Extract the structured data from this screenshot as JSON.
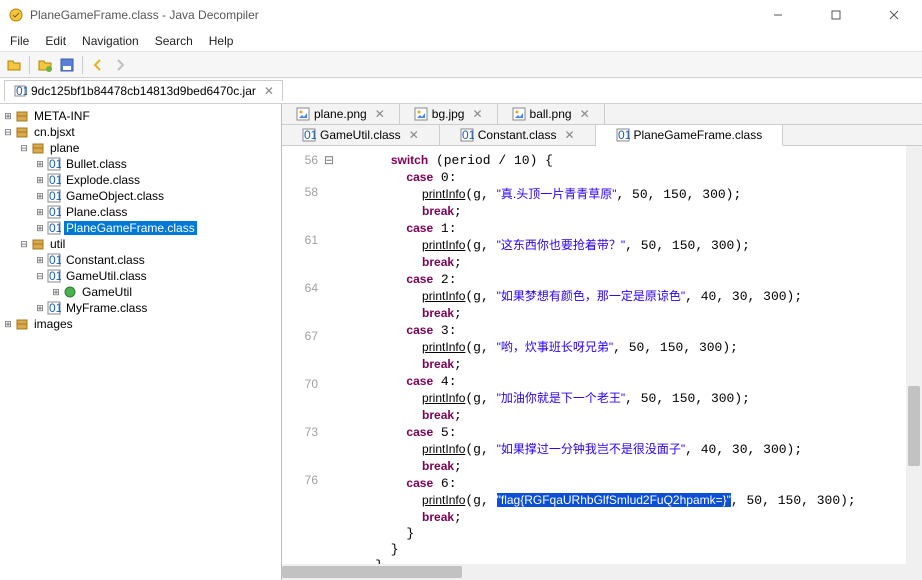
{
  "window": {
    "title": "PlaneGameFrame.class - Java Decompiler"
  },
  "menu": {
    "file": "File",
    "edit": "Edit",
    "navigation": "Navigation",
    "search": "Search",
    "help": "Help"
  },
  "filetab": {
    "label": "9dc125bf1b84478cb14813d9bed6470c.jar",
    "close": "✕"
  },
  "tree": [
    {
      "depth": 0,
      "exp": "+",
      "icon": "package",
      "label": "META-INF"
    },
    {
      "depth": 0,
      "exp": "-",
      "icon": "package",
      "label": "cn.bjsxt"
    },
    {
      "depth": 1,
      "exp": "-",
      "icon": "package",
      "label": "plane"
    },
    {
      "depth": 2,
      "exp": "+",
      "icon": "class",
      "label": "Bullet.class"
    },
    {
      "depth": 2,
      "exp": "+",
      "icon": "class",
      "label": "Explode.class"
    },
    {
      "depth": 2,
      "exp": "+",
      "icon": "class",
      "label": "GameObject.class"
    },
    {
      "depth": 2,
      "exp": "+",
      "icon": "class",
      "label": "Plane.class"
    },
    {
      "depth": 2,
      "exp": "+",
      "icon": "class",
      "label": "PlaneGameFrame.class",
      "selected": true
    },
    {
      "depth": 1,
      "exp": "-",
      "icon": "package",
      "label": "util"
    },
    {
      "depth": 2,
      "exp": "+",
      "icon": "class",
      "label": "Constant.class"
    },
    {
      "depth": 2,
      "exp": "-",
      "icon": "class",
      "label": "GameUtil.class"
    },
    {
      "depth": 3,
      "exp": "+",
      "icon": "member",
      "label": "GameUtil"
    },
    {
      "depth": 2,
      "exp": "+",
      "icon": "class",
      "label": "MyFrame.class"
    },
    {
      "depth": 0,
      "exp": "+",
      "icon": "package",
      "label": "images"
    }
  ],
  "editor_tabs": {
    "row1": [
      {
        "icon": "img",
        "label": "plane.png",
        "close": "✕"
      },
      {
        "icon": "img",
        "label": "bg.jpg",
        "close": "✕"
      },
      {
        "icon": "img",
        "label": "ball.png",
        "close": "✕"
      }
    ],
    "row2": [
      {
        "icon": "class",
        "label": "GameUtil.class",
        "close": "✕"
      },
      {
        "icon": "class",
        "label": "Constant.class",
        "close": "✕"
      },
      {
        "icon": "class",
        "label": "PlaneGameFrame.class",
        "active": true
      }
    ]
  },
  "code": {
    "line_numbers": [
      "56",
      "",
      "58",
      "",
      "",
      "61",
      "",
      "",
      "64",
      "",
      "",
      "67",
      "",
      "",
      "70",
      "",
      "",
      "73",
      "",
      "",
      "76",
      "",
      "",
      "",
      ""
    ],
    "switch_kw": "switch",
    "switch_expr": " (period / 10) {",
    "case_kw": "case",
    "break_kw": "break",
    "print_fn": "printInfo",
    "cases": [
      {
        "n": "0",
        "str": "\"真.头顶一片青青草原\"",
        "args": ", 50, 150, 300);"
      },
      {
        "n": "1",
        "str": "\"这东西你也要抢着带？\"",
        "args": ", 50, 150, 300);"
      },
      {
        "n": "2",
        "str": "\"如果梦想有颜色，那一定是原谅色\"",
        "args": ", 40, 30, 300);"
      },
      {
        "n": "3",
        "str": "\"哟，炊事班长呀兄弟\"",
        "args": ", 50, 150, 300);"
      },
      {
        "n": "4",
        "str": "\"加油你就是下一个老王\"",
        "args": ", 50, 150, 300);"
      },
      {
        "n": "5",
        "str": "\"如果撑过一分钟我岂不是很没面子\"",
        "args": ", 40, 30, 300);"
      },
      {
        "n": "6",
        "str": "\"flag{RGFqaURhbGlfSmlud2FuQ2hpamk=}\"",
        "args": ", 50, 150, 300);",
        "highlight": true
      }
    ]
  }
}
